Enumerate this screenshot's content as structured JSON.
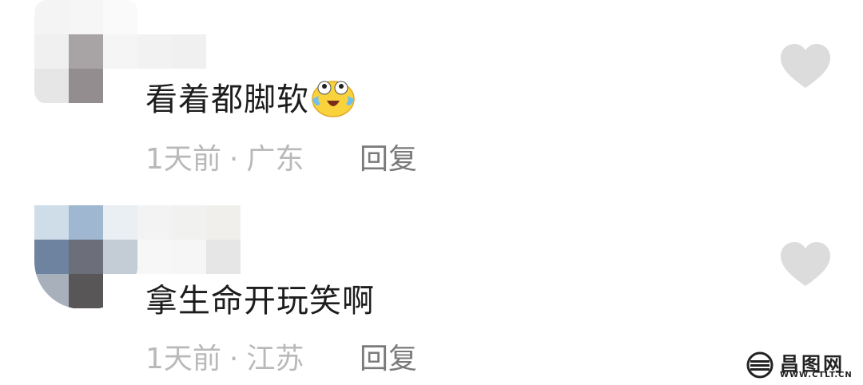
{
  "comments": [
    {
      "text": "看着都脚软",
      "emoji": "crying-laughing-face-emoji",
      "time": "1天前",
      "separator": "·",
      "location": "广东",
      "reply_label": "回复",
      "like_icon": "heart-icon"
    },
    {
      "text": "拿生命开玩笑啊",
      "time": "1天前",
      "separator": "·",
      "location": "江苏",
      "reply_label": "回复",
      "like_icon": "heart-icon"
    }
  ],
  "watermark": {
    "title": "昌图网",
    "url": "WWW.CTLT.CN"
  },
  "colors": {
    "text": "#1d1d1d",
    "meta": "#b9b9b9",
    "reply": "#7a7a7a",
    "heart": "#dcdcdc"
  }
}
